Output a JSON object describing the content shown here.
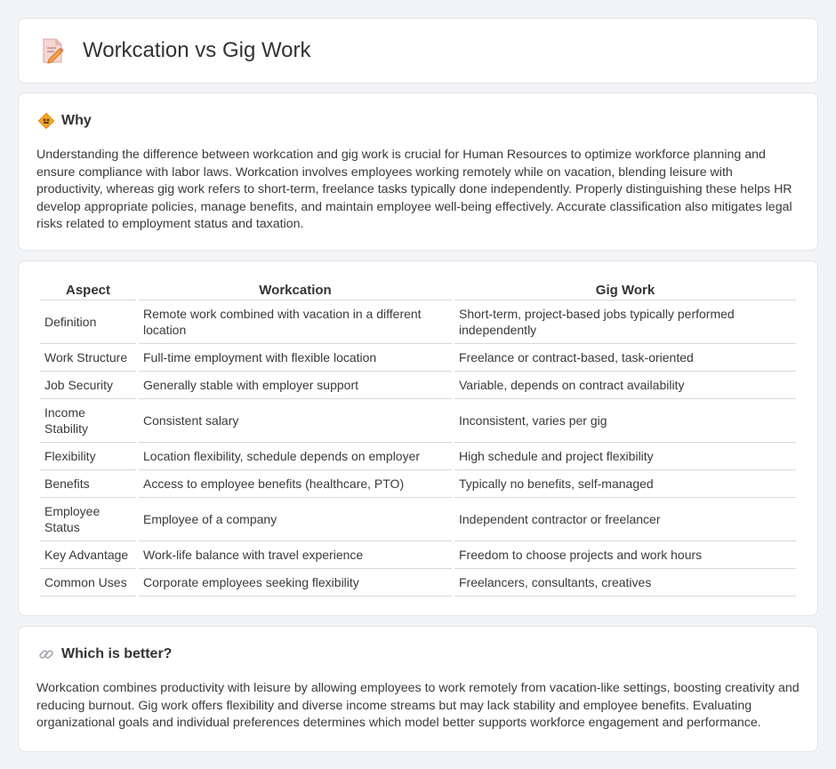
{
  "header": {
    "title": "Workcation vs Gig Work",
    "icon": "document-edit-icon"
  },
  "why": {
    "title": "Why",
    "icon": "warning-sign-icon",
    "text": "Understanding the difference between workcation and gig work is crucial for Human Resources to optimize workforce planning and ensure compliance with labor laws. Workcation involves employees working remotely while on vacation, blending leisure with productivity, whereas gig work refers to short-term, freelance tasks typically done independently. Properly distinguishing these helps HR develop appropriate policies, manage benefits, and maintain employee well-being effectively. Accurate classification also mitigates legal risks related to employment status and taxation."
  },
  "table": {
    "headers": [
      "Aspect",
      "Workcation",
      "Gig Work"
    ],
    "rows": [
      [
        "Definition",
        "Remote work combined with vacation in a different location",
        "Short-term, project-based jobs typically performed independently"
      ],
      [
        "Work Structure",
        "Full-time employment with flexible location",
        "Freelance or contract-based, task-oriented"
      ],
      [
        "Job Security",
        "Generally stable with employer support",
        "Variable, depends on contract availability"
      ],
      [
        "Income Stability",
        "Consistent salary",
        "Inconsistent, varies per gig"
      ],
      [
        "Flexibility",
        "Location flexibility, schedule depends on employer",
        "High schedule and project flexibility"
      ],
      [
        "Benefits",
        "Access to employee benefits (healthcare, PTO)",
        "Typically no benefits, self-managed"
      ],
      [
        "Employee Status",
        "Employee of a company",
        "Independent contractor or freelancer"
      ],
      [
        "Key Advantage",
        "Work-life balance with travel experience",
        "Freedom to choose projects and work hours"
      ],
      [
        "Common Uses",
        "Corporate employees seeking flexibility",
        "Freelancers, consultants, creatives"
      ]
    ]
  },
  "better": {
    "title": "Which is better?",
    "icon": "link-icon",
    "text": "Workcation combines productivity with leisure by allowing employees to work remotely from vacation-like settings, boosting creativity and reducing burnout. Gig work offers flexibility and diverse income streams but may lack stability and employee benefits. Evaluating organizational goals and individual preferences determines which model better supports workforce engagement and performance."
  }
}
